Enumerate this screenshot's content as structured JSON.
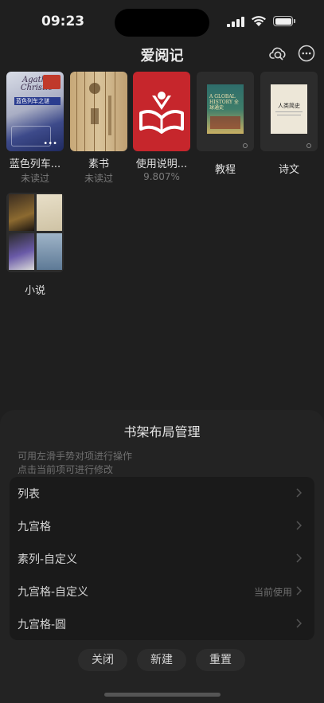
{
  "status": {
    "time": "09:23"
  },
  "nav": {
    "title": "爱阅记"
  },
  "books": [
    {
      "title": "蓝色列车...",
      "subtitle": "未读过",
      "cover_title": "蓝色列车之谜",
      "cover_author": "Agatha Christie"
    },
    {
      "title": "素书",
      "subtitle": "未读过"
    },
    {
      "title": "使用说明...",
      "subtitle": "9.807%"
    }
  ],
  "folders": [
    {
      "label": "教程",
      "cover_text": "A GLOBAL HISTORY 全球通史"
    },
    {
      "label": "诗文",
      "cover_text": "人类简史"
    },
    {
      "label": "小说"
    }
  ],
  "sheet": {
    "title": "书架布局管理",
    "hint_1": "可用左滑手势对项进行操作",
    "hint_2": "点击当前项可进行修改",
    "options": [
      {
        "label": "列表",
        "status": ""
      },
      {
        "label": "九宫格",
        "status": ""
      },
      {
        "label": "素列-自定义",
        "status": ""
      },
      {
        "label": "九宫格-自定义",
        "status": "当前使用"
      },
      {
        "label": "九宫格-圆",
        "status": ""
      }
    ],
    "buttons": {
      "close": "关闭",
      "new": "新建",
      "reset": "重置"
    }
  }
}
